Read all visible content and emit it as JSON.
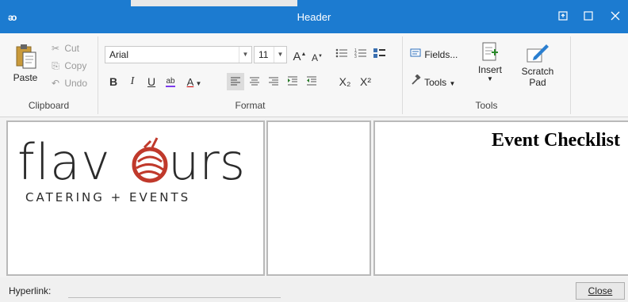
{
  "window": {
    "title": "Header",
    "app_icon": "ᴔ"
  },
  "clipboard": {
    "paste_label": "Paste",
    "cut_label": "Cut",
    "copy_label": "Copy",
    "undo_label": "Undo",
    "group_label": "Clipboard"
  },
  "format": {
    "font_name": "Arial",
    "font_size": "11",
    "group_label": "Format",
    "grow_font": "A",
    "shrink_font": "A",
    "bold": "B",
    "italic": "I",
    "underline": "U",
    "highlight": "ab",
    "font_color": "A",
    "subscript": "X₂",
    "superscript": "X²"
  },
  "tools": {
    "fields_label": "Fields...",
    "tools_label": "Tools",
    "insert_label": "Insert",
    "scratch_label": "Scratch Pad",
    "group_label": "Tools"
  },
  "content": {
    "logo_word": "flavours",
    "logo_tagline": "CATERING + EVENTS",
    "event_title": "Event Checklist"
  },
  "statusbar": {
    "hyperlink_label": "Hyperlink:",
    "hyperlink_value": "",
    "close_label": "Close"
  },
  "colors": {
    "titlebar": "#1c7bd0",
    "logo_accent": "#c0392b",
    "logo_text": "#2b2b2b"
  }
}
